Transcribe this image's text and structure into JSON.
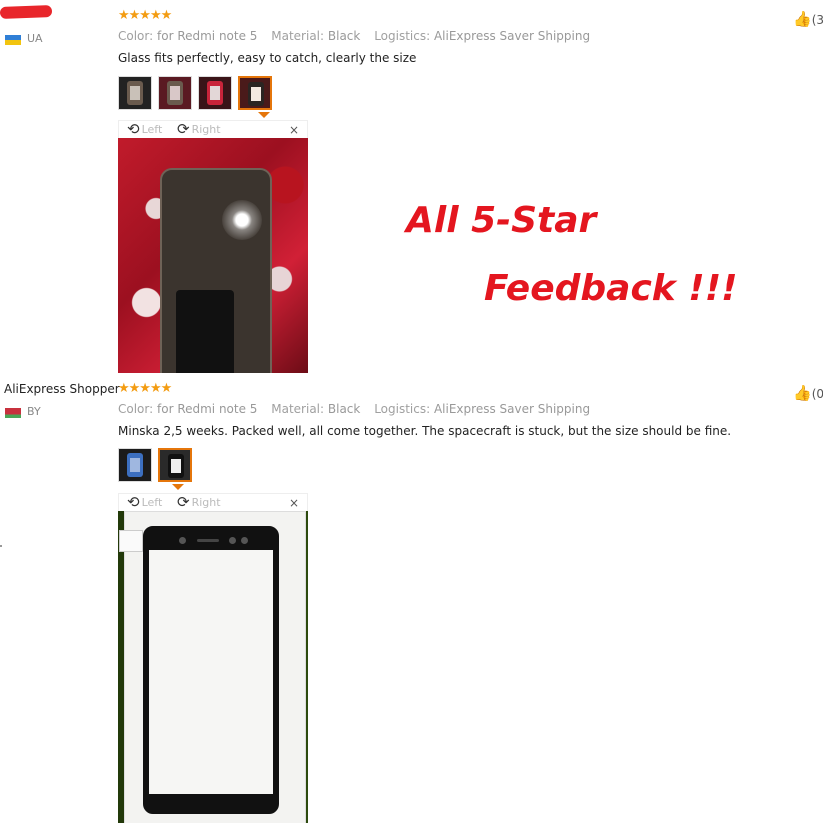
{
  "colors": {
    "promo": "#e4161f",
    "star": "#f39c12",
    "selected_border": "#e5760b"
  },
  "promo": {
    "line1": "All 5-Star",
    "line2": "Feedback !!!"
  },
  "reviews": [
    {
      "country": "UA",
      "stars": "★★★★★",
      "color_label": "Color:",
      "color_value": "for Redmi note 5",
      "material_label": "Material:",
      "material_value": "Black",
      "logistics_label": "Logistics:",
      "logistics_value": "AliExpress Saver Shipping",
      "text": "Glass fits perfectly, easy to catch, clearly the size",
      "like_count": "(3",
      "viewer": {
        "left": "Left",
        "right": "Right",
        "close": "×"
      }
    },
    {
      "shopper": "AliExpress Shopper",
      "country": "BY",
      "stars": "★★★★★",
      "color_label": "Color:",
      "color_value": "for Redmi note 5",
      "material_label": "Material:",
      "material_value": "Black",
      "logistics_label": "Logistics:",
      "logistics_value": "AliExpress Saver Shipping",
      "text": "Minska 2,5 weeks. Packed well, all come together. The spacecraft is stuck, but the size should be fine.",
      "like_count": "(0",
      "viewer": {
        "left": "Left",
        "right": "Right",
        "close": "×"
      }
    }
  ]
}
